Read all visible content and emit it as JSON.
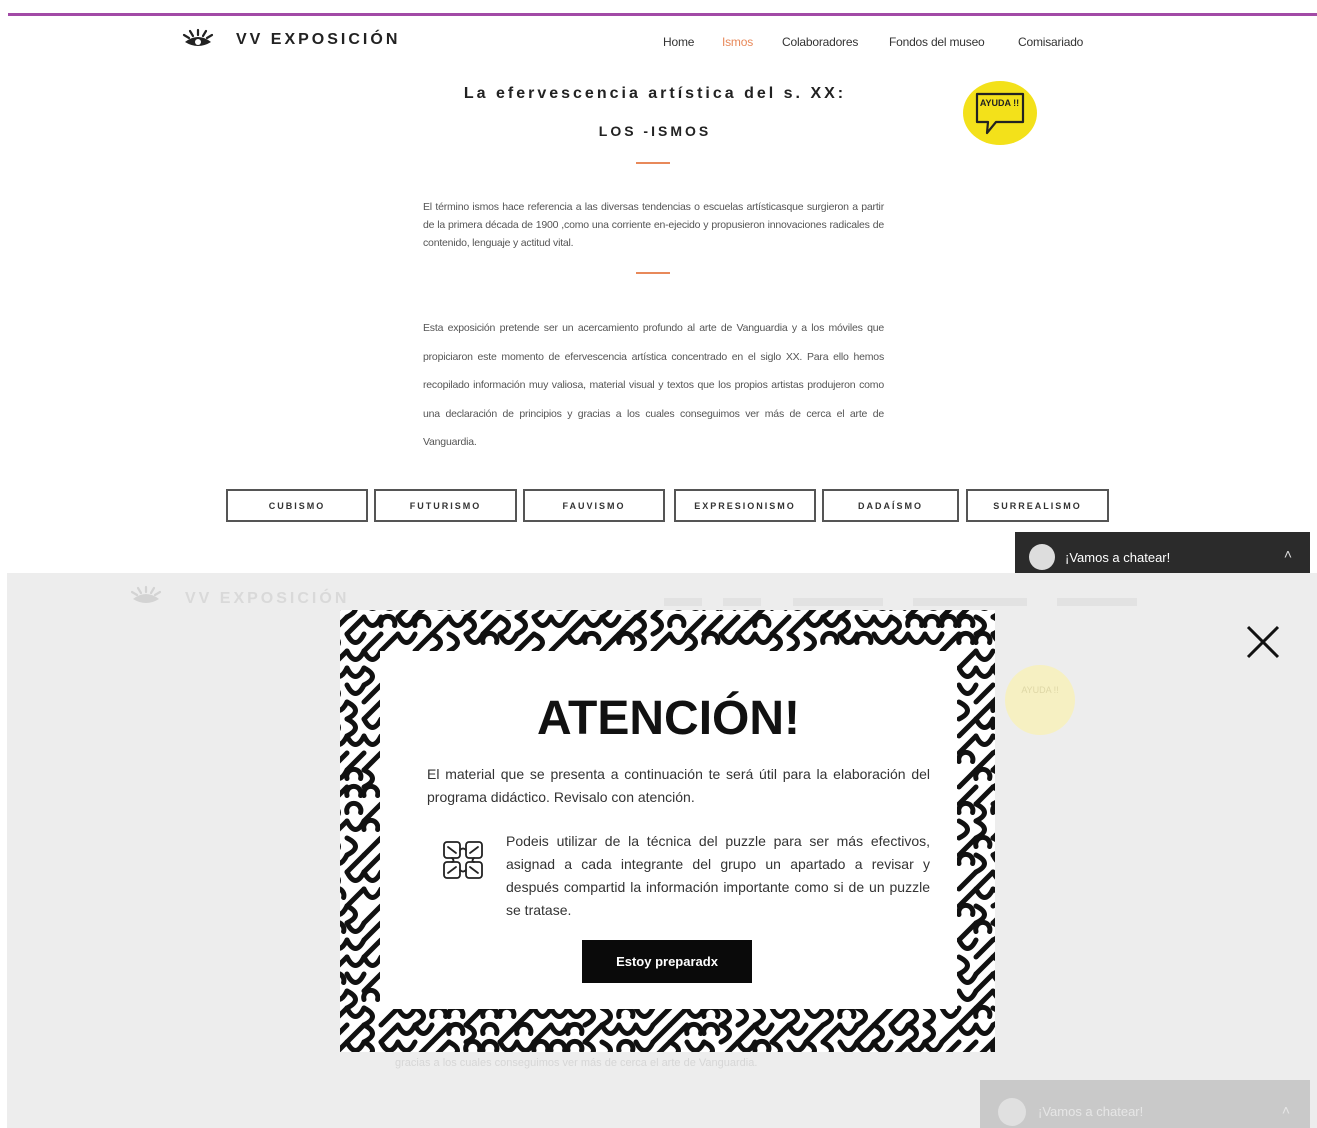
{
  "site": {
    "name": "VV EXPOSICIÓN",
    "nav": [
      "Home",
      "Ismos",
      "Colaboradores",
      "Fondos del museo",
      "Comisariado"
    ],
    "active_nav": "Ismos",
    "help_badge": "AYUDA !!"
  },
  "main": {
    "heading_1": "La efervescencia artística del s. XX:",
    "heading_2": "LOS -ISMOS",
    "paragraph_1": "El término ismos hace referencia a las diversas tendencias o escuelas artísticasque surgieron a partir de la primera década de 1900 ,como una corriente en-ejecido y propusieron innovaciones radicales de contenido, lenguaje y actitud vital.",
    "paragraph_2": "Esta exposición pretende ser un acercamiento profundo al arte de Vanguardia y a los móviles que propiciaron este momento de efervescencia artística concentrado en el siglo XX. Para ello hemos recopilado información muy valiosa, material visual y textos que los propios artistas produjeron como una declaración de principios y gracias a los cuales conseguimos ver más de cerca el arte de Vanguardia.",
    "ismo_buttons": [
      "CUBISMO",
      "FUTURISMO",
      "FAUVISMO",
      "EXPRESIONISMO",
      "DADAÍSMO",
      "SURREALISMO"
    ]
  },
  "chat": {
    "label": "¡Vamos a chatear!"
  },
  "modal": {
    "title": "ATENCIÓN!",
    "text_1": "El material que se presenta a continuación te será útil para la elaboración del programa didáctico. Revisalo con atención.",
    "text_2": "Podeis utilizar de la técnica del puzzle para ser más efectivos, asignad a cada integrante del grupo un apartado a revisar y después compartid la información importante como si de un puzzle se tratase.",
    "button": "Estoy preparadx"
  },
  "ghost_text": "gracias a los cuales conseguimos ver más de cerca el arte de Vanguardia.",
  "colors": {
    "accent_purple": "#a24aa6",
    "accent_orange": "#e8895a",
    "help_yellow": "#f3e11a",
    "dark": "#0a0a0a"
  }
}
